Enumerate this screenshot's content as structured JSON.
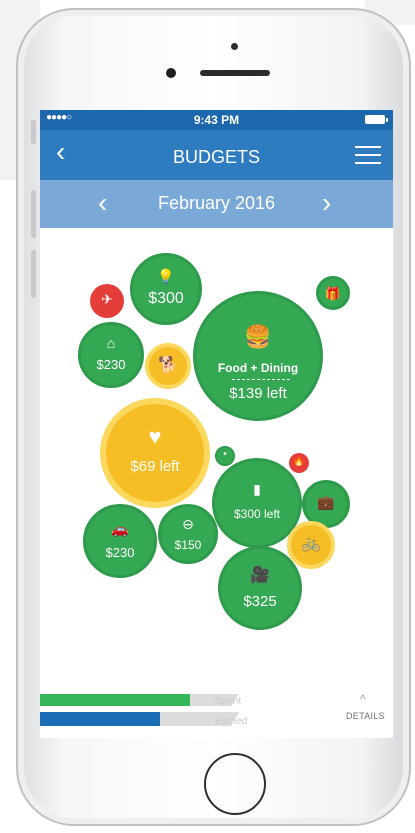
{
  "status_bar": {
    "signal": "●●●●○",
    "time": "9:43 PM"
  },
  "nav": {
    "back_icon": "‹",
    "title": "BUDGETS",
    "menu_icon": "hamburger-menu"
  },
  "month": {
    "prev_icon": "‹",
    "label": "February 2016",
    "next_icon": "›"
  },
  "bubbles": {
    "travel": {
      "icon": "✈",
      "color": "#e43d3a"
    },
    "utilities": {
      "icon": "💡",
      "amount": "$300",
      "color": "#35a853"
    },
    "gifts": {
      "icon": "🎁",
      "color": "#35a853"
    },
    "home": {
      "icon": "⌂",
      "amount": "$230",
      "color": "#35a853"
    },
    "pets": {
      "icon": "🐕",
      "color": "#f7bd25"
    },
    "food_dining": {
      "icon": "🍔",
      "label": "Food + Dining",
      "amount": "$139 left",
      "color": "#35a853"
    },
    "health": {
      "icon": "♥",
      "amount": "$69 left",
      "color": "#f7bd25"
    },
    "small_green": {
      "icon": "•",
      "color": "#35a853"
    },
    "small_red": {
      "icon": "🔥",
      "color": "#e43d3a"
    },
    "shopping": {
      "icon": "▮",
      "amount": "$300 left",
      "color": "#35a853"
    },
    "business": {
      "icon": "💼",
      "color": "#35a853"
    },
    "auto": {
      "icon": "🚗",
      "amount": "$230",
      "color": "#35a853"
    },
    "fees": {
      "icon": "⊖",
      "amount": "$150",
      "color": "#35a853"
    },
    "sports": {
      "icon": "🚲",
      "color": "#f7bd25"
    },
    "entertainment": {
      "icon": "🎥",
      "amount": "$325",
      "color": "#35a853"
    }
  },
  "footer": {
    "spent_label": "Spent",
    "earned_label": "Earned",
    "details_caret": "^",
    "details_label": "DETAILS",
    "spent_color": "#34b55a",
    "earned_color": "#1b6eb6"
  }
}
